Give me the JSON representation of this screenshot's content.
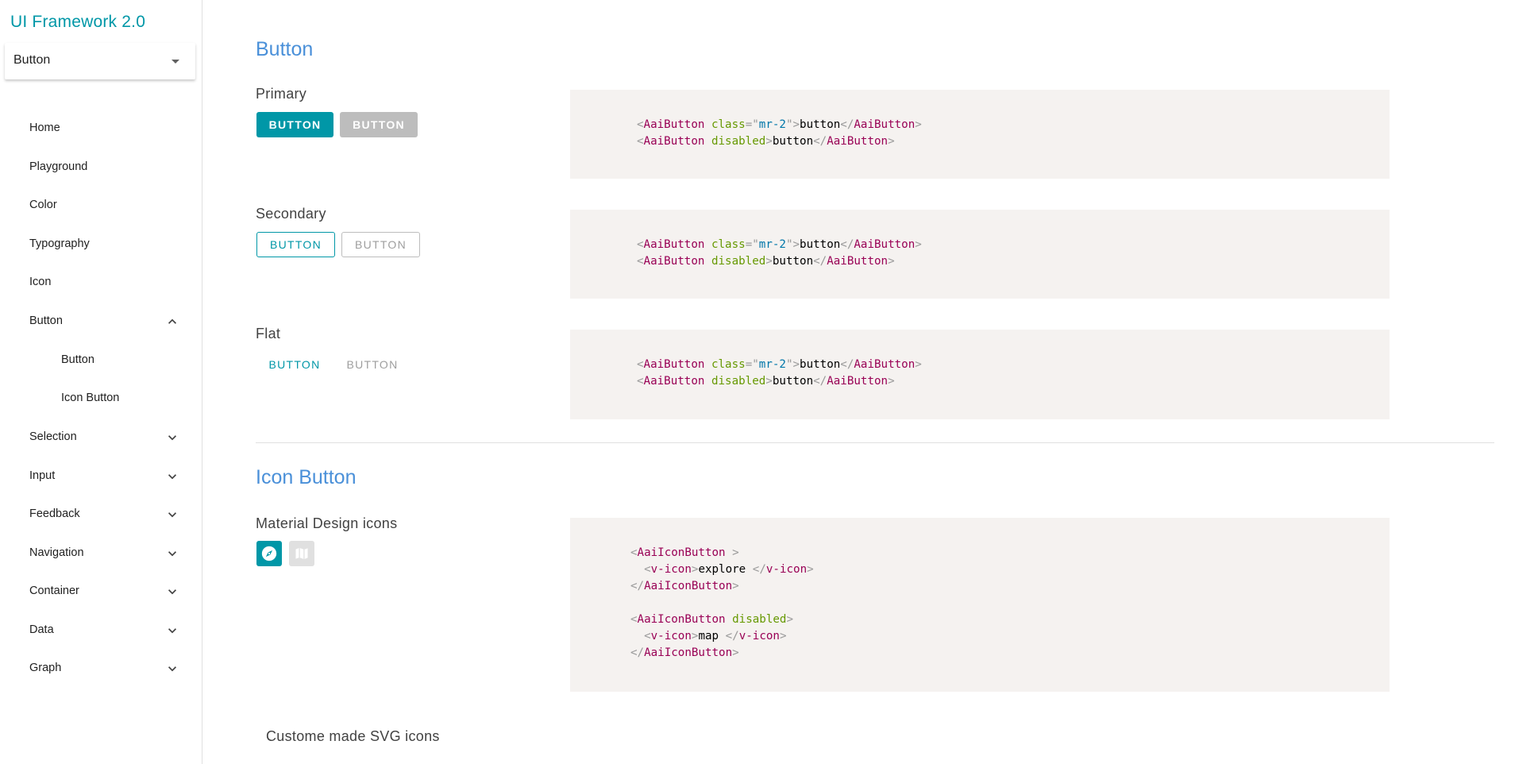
{
  "app_title": "UI Framework 2.0",
  "page_select": {
    "value": "Button",
    "icon": "caret-down-icon"
  },
  "nav": {
    "home": "Home",
    "playground": "Playground",
    "color": "Color",
    "typography": "Typography",
    "icon": "Icon",
    "button": "Button",
    "button_sub": "Button",
    "icon_button_sub": "Icon Button",
    "selection": "Selection",
    "input": "Input",
    "feedback": "Feedback",
    "navigation": "Navigation",
    "container": "Container",
    "data": "Data",
    "graph": "Graph"
  },
  "button_section": {
    "title": "Button",
    "primary": {
      "heading": "Primary",
      "button": "Button",
      "disabled_button": "Button"
    },
    "secondary": {
      "heading": "Secondary",
      "button": "Button",
      "disabled_button": "Button"
    },
    "flat": {
      "heading": "Flat",
      "button": "Button",
      "disabled_button": "Button"
    },
    "code": {
      "tag": "AaiButton",
      "attr_class": "class",
      "attr_class_value": "mr-2",
      "attr_disabled": "disabled",
      "content": "button"
    }
  },
  "icon_button_section": {
    "title": "Icon Button",
    "material_heading": "Material Design icons",
    "custom_heading": "Custome made SVG icons",
    "icons": [
      "compass-icon",
      "map-icon"
    ],
    "code": {
      "tag": "AaiIconButton",
      "inner_tag": "v-icon",
      "attr_disabled": "disabled",
      "content_1": "explore",
      "content_2": "map"
    }
  },
  "colors": {
    "accent": "#0097a7",
    "heading": "#4a90d9",
    "code_background": "#f5f2f0"
  }
}
